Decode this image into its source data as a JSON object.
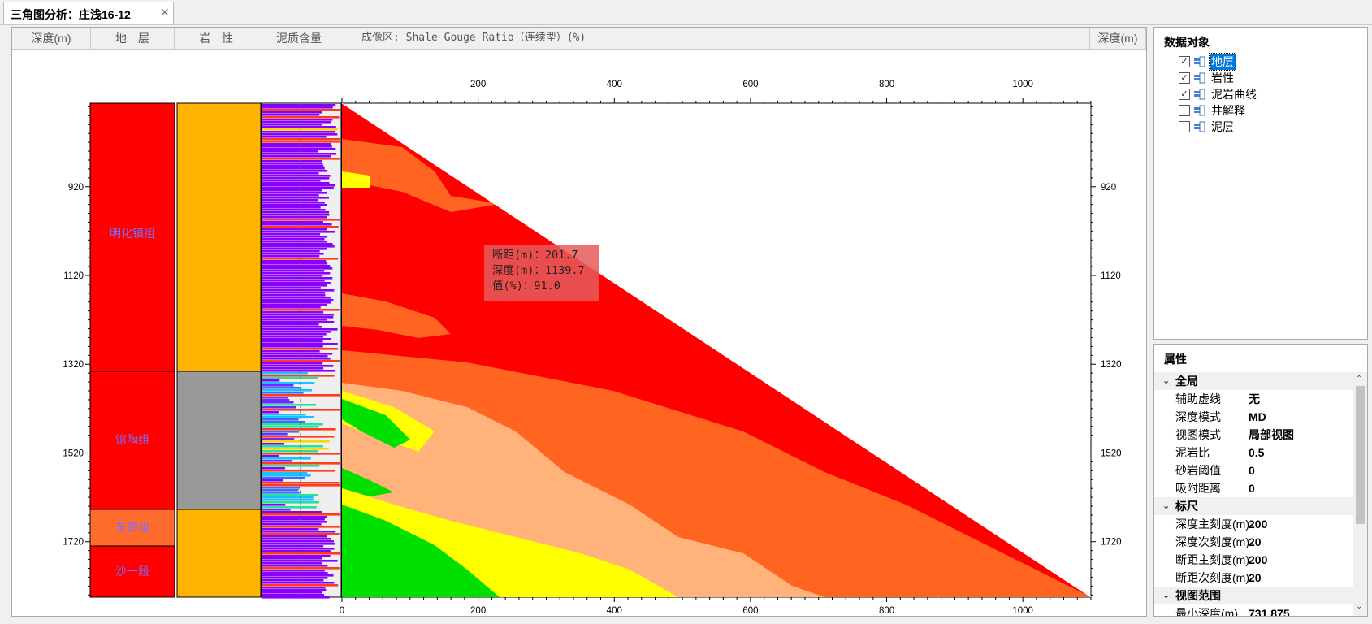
{
  "tab": {
    "title": "三角图分析：庄浅16-12",
    "close": "✕"
  },
  "headers": {
    "depth_left": "深度(m)",
    "formation": "地　层",
    "lithology": "岩　性",
    "shale": "泥质含量",
    "imaging": "成像区: Shale Gouge Ratio（连续型）(%)",
    "depth_right": "深度(m)"
  },
  "depth_ticks": [
    "920",
    "1120",
    "1320",
    "1520",
    "1720"
  ],
  "throw_ticks": [
    "0",
    "200",
    "400",
    "600",
    "800",
    "1000"
  ],
  "formations": [
    {
      "name": "明化镇组",
      "color": "#ff0000"
    },
    {
      "name": "馆陶组",
      "color": "#ff0000"
    },
    {
      "name": "东营组",
      "color": "#ff6b2d"
    },
    {
      "name": "沙一段",
      "color": "#ff0000"
    }
  ],
  "lithology_colors": {
    "sand": "#ffb300",
    "shale": "#999999"
  },
  "tooltip": {
    "line1": "断距(m)：201.7",
    "line2": "深度(m)：1139.7",
    "line3": "值(%)：91.0"
  },
  "data_objects": {
    "title": "数据对象",
    "items": [
      {
        "label": "地层",
        "checked": true,
        "selected": true
      },
      {
        "label": "岩性",
        "checked": true,
        "selected": false
      },
      {
        "label": "泥岩曲线",
        "checked": true,
        "selected": false
      },
      {
        "label": "井解释",
        "checked": false,
        "selected": false
      },
      {
        "label": "泥层",
        "checked": false,
        "selected": false
      }
    ]
  },
  "properties": {
    "title": "属性",
    "groups": [
      {
        "name": "全局",
        "rows": [
          {
            "key": "辅助虚线",
            "value": "无"
          },
          {
            "key": "深度模式",
            "value": "MD"
          },
          {
            "key": "视图模式",
            "value": "局部视图"
          },
          {
            "key": "泥岩比",
            "value": "0.5"
          },
          {
            "key": "砂岩阈值",
            "value": "0"
          },
          {
            "key": "吸附距离",
            "value": "0"
          }
        ]
      },
      {
        "name": "标尺",
        "rows": [
          {
            "key": "深度主刻度(m)",
            "value": "200"
          },
          {
            "key": "深度次刻度(m)",
            "value": "20"
          },
          {
            "key": "断距主刻度(m)",
            "value": "200"
          },
          {
            "key": "断距次刻度(m)",
            "value": "20"
          }
        ]
      },
      {
        "name": "视图范围",
        "rows": [
          {
            "key": "最小深度(m)",
            "value": "731.875"
          }
        ]
      }
    ]
  },
  "colors": {
    "sgr_high": "#ff0000",
    "sgr_mid": "#ff6420",
    "sgr_lowmid": "#ffb27a",
    "sgr_low": "#ffff00",
    "sgr_min": "#00e000",
    "selection": "#0078d7"
  }
}
